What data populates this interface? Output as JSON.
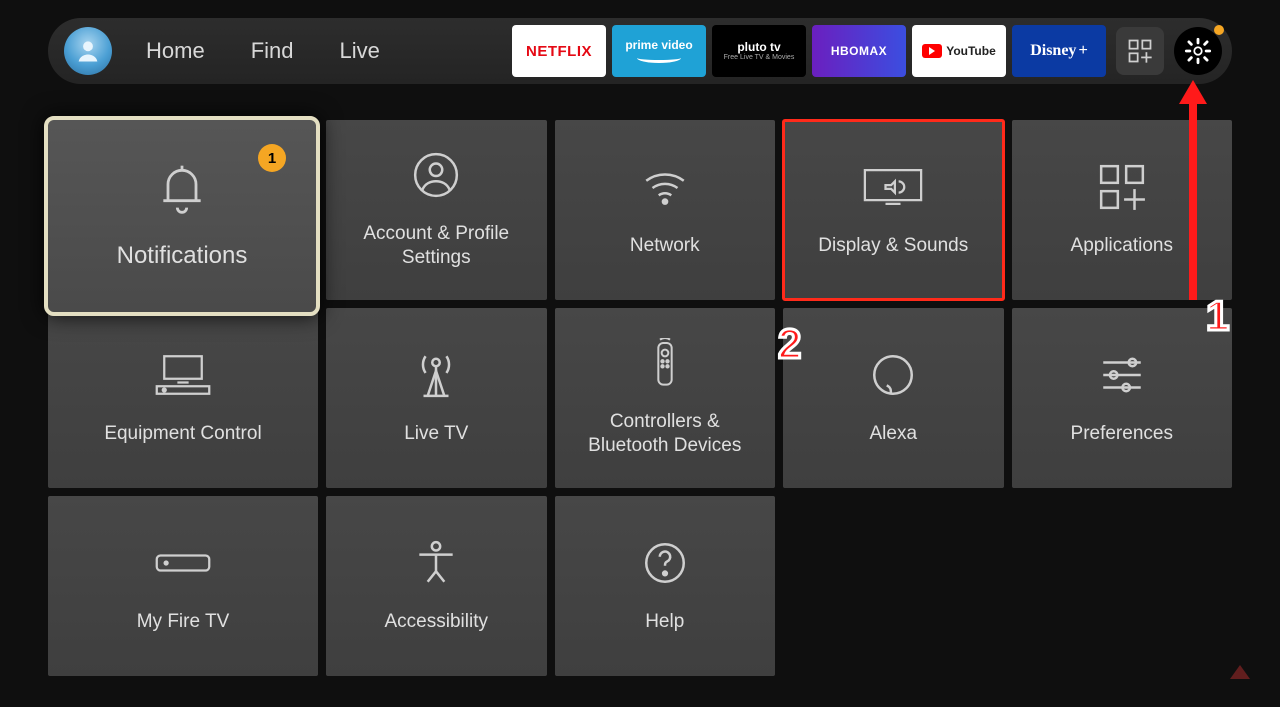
{
  "nav": {
    "links": [
      "Home",
      "Find",
      "Live"
    ],
    "apps": [
      {
        "id": "netflix",
        "label": "NETFLIX"
      },
      {
        "id": "prime",
        "label": "prime video"
      },
      {
        "id": "pluto",
        "label": "pluto tv",
        "sub": "Free Live TV & Movies"
      },
      {
        "id": "hbomax",
        "label": "HBOMAX"
      },
      {
        "id": "youtube",
        "label": "YouTube"
      },
      {
        "id": "disney",
        "label": "Disney",
        "suffix": "+"
      }
    ]
  },
  "badge_count": "1",
  "tiles": [
    {
      "id": "notifications",
      "label": "Notifications"
    },
    {
      "id": "account",
      "label": "Account & Profile Settings"
    },
    {
      "id": "network",
      "label": "Network"
    },
    {
      "id": "display",
      "label": "Display & Sounds"
    },
    {
      "id": "applications",
      "label": "Applications"
    },
    {
      "id": "equipment",
      "label": "Equipment Control"
    },
    {
      "id": "livetv",
      "label": "Live TV"
    },
    {
      "id": "controllers",
      "label": "Controllers & Bluetooth Devices"
    },
    {
      "id": "alexa",
      "label": "Alexa"
    },
    {
      "id": "preferences",
      "label": "Preferences"
    },
    {
      "id": "myfiretv",
      "label": "My Fire TV"
    },
    {
      "id": "accessibility",
      "label": "Accessibility"
    },
    {
      "id": "help",
      "label": "Help"
    }
  ],
  "callouts": {
    "one": "1",
    "two": "2"
  }
}
